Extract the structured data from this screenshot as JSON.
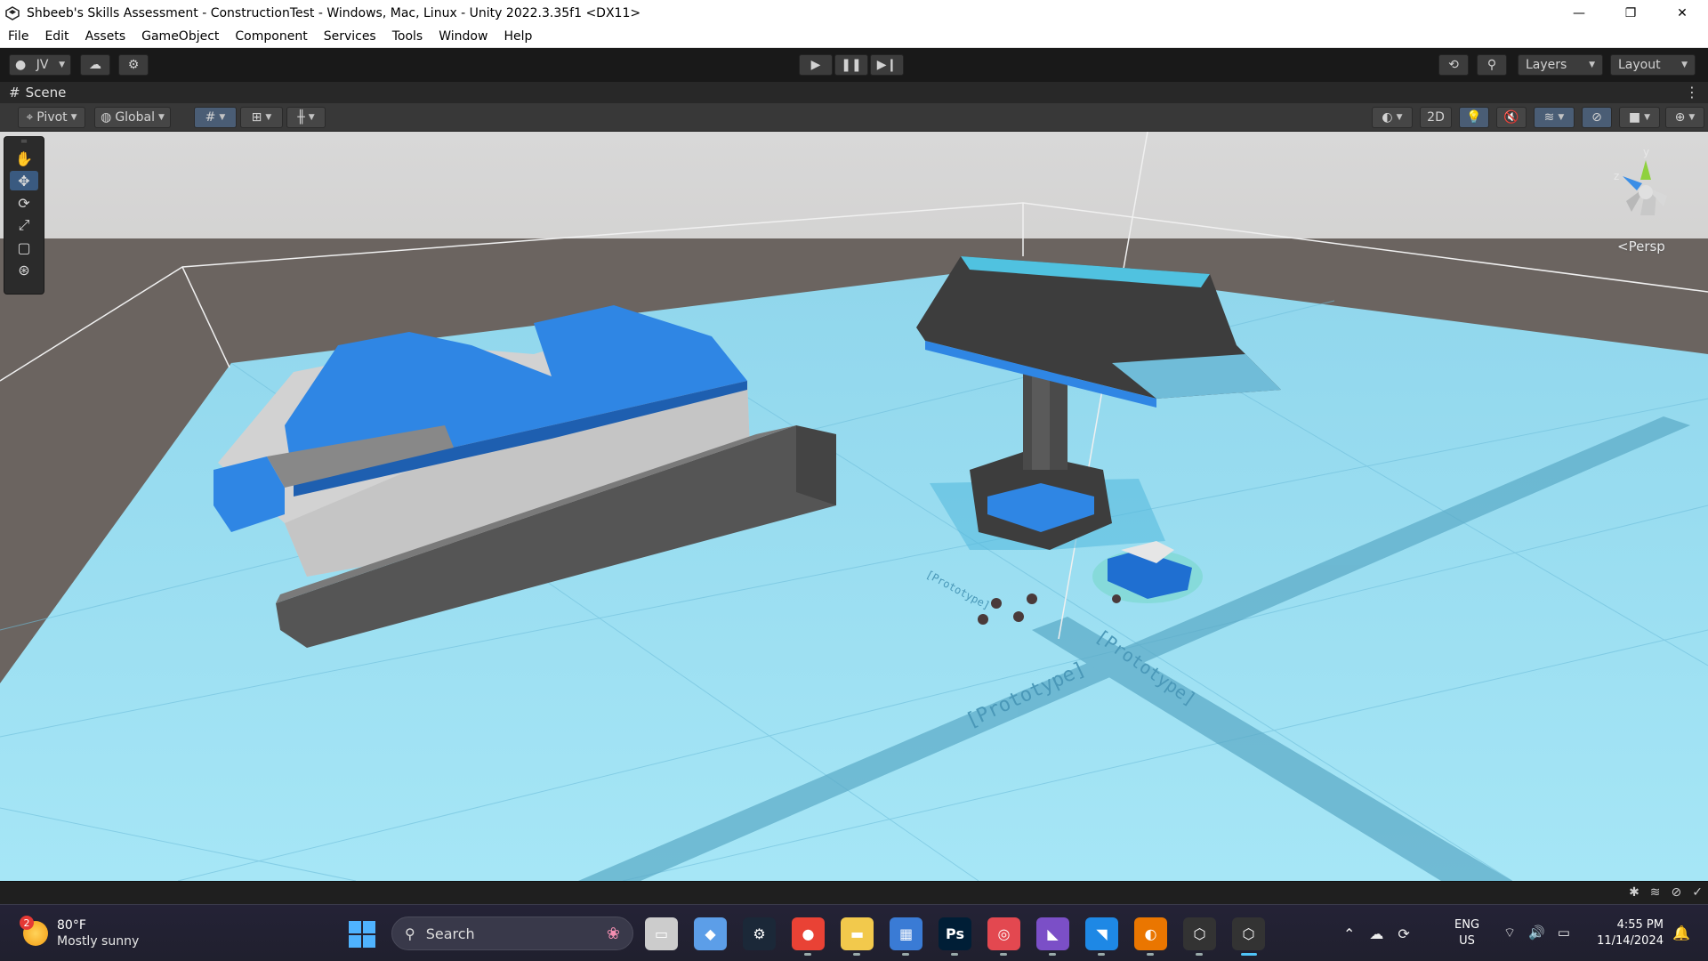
{
  "window": {
    "title": "Shbeeb's Skills Assessment - ConstructionTest - Windows, Mac, Linux - Unity 2022.3.35f1 <DX11>",
    "controls": [
      "—",
      "❐",
      "✕"
    ]
  },
  "menu": [
    "File",
    "Edit",
    "Assets",
    "GameObject",
    "Component",
    "Services",
    "Tools",
    "Window",
    "Help"
  ],
  "toolbar": {
    "account": "JV",
    "layers": "Layers",
    "layout": "Layout"
  },
  "scene_tab": {
    "label": "Scene"
  },
  "scene_toolbar": {
    "pivot": "Pivot",
    "global": "Global",
    "mode_2d": "2D"
  },
  "scene": {
    "camera_mode": "Persp",
    "gizmo_axes": [
      "y",
      "z"
    ],
    "ground_texts": [
      "[Prototype]",
      "[Prototype]",
      "[Prototype]"
    ],
    "tools": [
      "hand-icon",
      "move-icon",
      "rotate-icon",
      "scale-icon",
      "rect-icon",
      "transform-icon"
    ],
    "colors": {
      "ground": "#a0e0f4",
      "horizon": "#6b6460",
      "sky": "#d9d9d9",
      "roof_blue": "#2f86e4",
      "concrete": "#5a5a5a"
    }
  },
  "taskbar": {
    "weather_badge": "2",
    "temperature": "80°F",
    "condition": "Mostly sunny",
    "search_placeholder": "Search",
    "language": "ENG",
    "region": "US",
    "time": "4:55 PM",
    "date": "11/14/2024",
    "apps": [
      {
        "name": "task-view",
        "glyph": "▭",
        "color": "#cccccc"
      },
      {
        "name": "copilot",
        "glyph": "◆",
        "color": "#5c9ee8"
      },
      {
        "name": "steam",
        "glyph": "⚙",
        "color": "#1b2838"
      },
      {
        "name": "chrome",
        "glyph": "●",
        "color": "#e94235"
      },
      {
        "name": "file-explorer",
        "glyph": "▬",
        "color": "#f2c94c"
      },
      {
        "name": "microsoft-store",
        "glyph": "▦",
        "color": "#3a7bd5"
      },
      {
        "name": "photoshop",
        "glyph": "Ps",
        "color": "#001e36"
      },
      {
        "name": "creative-cloud",
        "glyph": "◎",
        "color": "#e34850"
      },
      {
        "name": "visual-studio",
        "glyph": "◣",
        "color": "#7b4fc7"
      },
      {
        "name": "vs-code",
        "glyph": "◥",
        "color": "#1e88e5"
      },
      {
        "name": "blender",
        "glyph": "◐",
        "color": "#ea7600"
      },
      {
        "name": "unity-hub",
        "glyph": "⬡",
        "color": "#333333"
      },
      {
        "name": "unity-editor",
        "glyph": "⬡",
        "color": "#333333"
      }
    ]
  }
}
